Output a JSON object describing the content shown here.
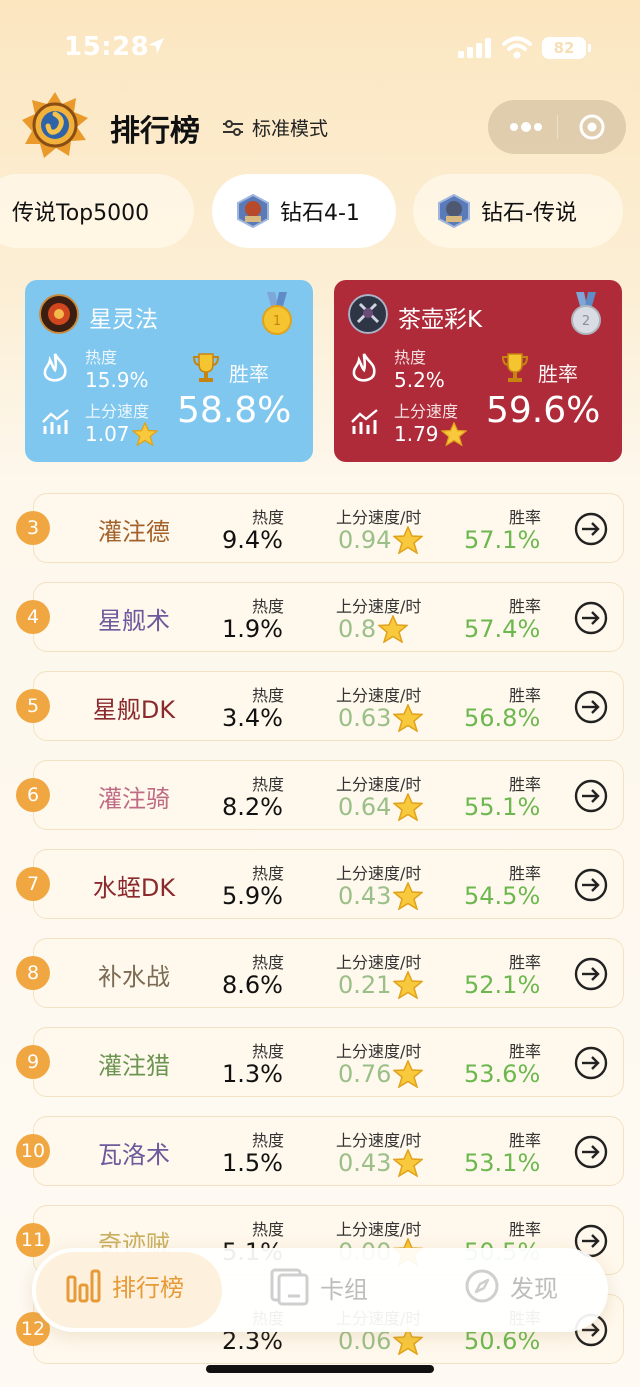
{
  "status_bar": {
    "time": "15:28",
    "battery": "82"
  },
  "header": {
    "title": "排行榜",
    "mode": "标准模式"
  },
  "tabs": [
    {
      "label": "传说Top5000",
      "active": false
    },
    {
      "label": "钻石4-1",
      "active": true
    },
    {
      "label": "钻石-传说",
      "active": false
    }
  ],
  "top_cards": [
    {
      "name": "星灵法",
      "hot_label": "热度",
      "hot": "15.9%",
      "speed_label": "上分速度",
      "speed": "1.07",
      "win_label": "胜率",
      "win_rate": "58.8%",
      "medal": "1"
    },
    {
      "name": "茶壶彩K",
      "hot_label": "热度",
      "hot": "5.2%",
      "speed_label": "上分速度",
      "speed": "1.79",
      "win_label": "胜率",
      "win_rate": "59.6%",
      "medal": "2"
    }
  ],
  "list_labels": {
    "hot": "热度",
    "speed": "上分速度/时",
    "win": "胜率"
  },
  "rows": [
    {
      "rank": "3",
      "name": "灌注德",
      "color": "#a3612b",
      "hot": "9.4%",
      "speed": "0.94",
      "win": "57.1%"
    },
    {
      "rank": "4",
      "name": "星舰术",
      "color": "#6d5a9c",
      "hot": "1.9%",
      "speed": "0.8",
      "win": "57.4%"
    },
    {
      "rank": "5",
      "name": "星舰DK",
      "color": "#8b2a2e",
      "hot": "3.4%",
      "speed": "0.63",
      "win": "56.8%"
    },
    {
      "rank": "6",
      "name": "灌注骑",
      "color": "#c06b86",
      "hot": "8.2%",
      "speed": "0.64",
      "win": "55.1%"
    },
    {
      "rank": "7",
      "name": "水蛭DK",
      "color": "#8b2a2e",
      "hot": "5.9%",
      "speed": "0.43",
      "win": "54.5%"
    },
    {
      "rank": "8",
      "name": "补水战",
      "color": "#7c6b55",
      "hot": "8.6%",
      "speed": "0.21",
      "win": "52.1%"
    },
    {
      "rank": "9",
      "name": "灌注猎",
      "color": "#6c9552",
      "hot": "1.3%",
      "speed": "0.76",
      "win": "53.6%"
    },
    {
      "rank": "10",
      "name": "瓦洛术",
      "color": "#6d5a9c",
      "hot": "1.5%",
      "speed": "0.43",
      "win": "53.1%"
    },
    {
      "rank": "11",
      "name": "奇迹贼",
      "color": "#c9b060",
      "hot": "5.1%",
      "speed": "0.00",
      "win": "50.5%"
    },
    {
      "rank": "12",
      "name": "",
      "color": "#6d5a9c",
      "hot": "2.3%",
      "speed": "0.06",
      "win": "50.6%"
    }
  ],
  "bottom_nav": [
    {
      "label": "排行榜",
      "icon": "bar-chart-icon",
      "active": true
    },
    {
      "label": "卡组",
      "icon": "deck-icon",
      "active": false
    },
    {
      "label": "发现",
      "icon": "compass-icon",
      "active": false
    }
  ],
  "colors": {
    "accent": "#f1a741",
    "win_green": "#6cb84f",
    "speed_green": "#9bbf88",
    "blue_card": "#7fc7ee",
    "red_card": "#b02b39"
  }
}
